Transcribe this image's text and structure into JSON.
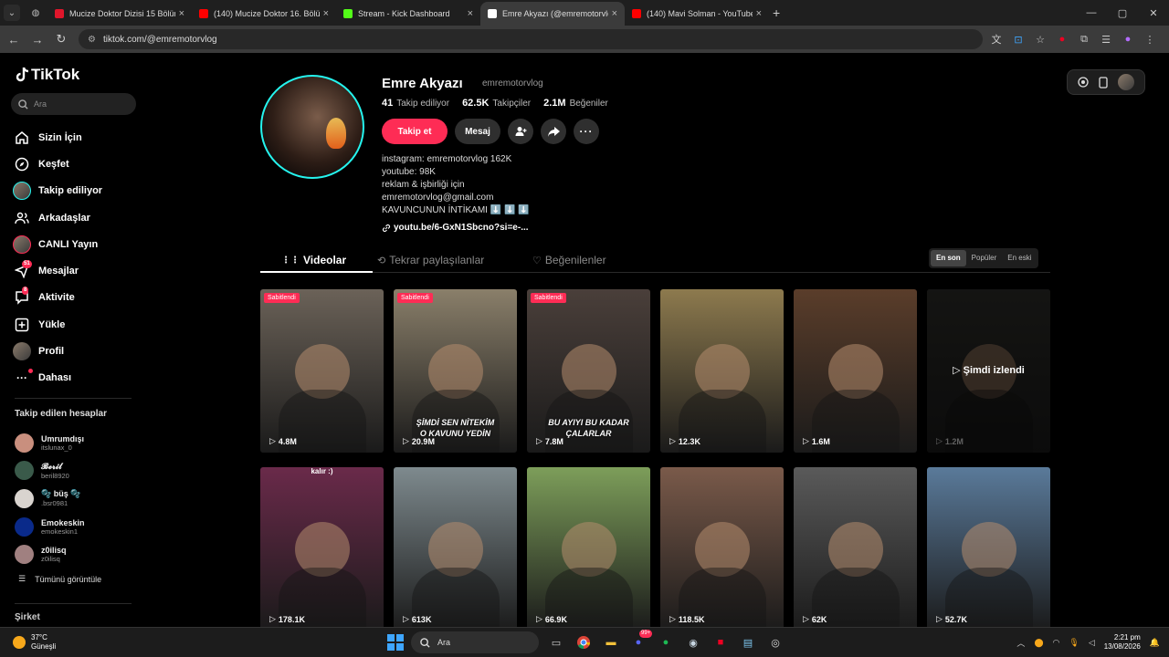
{
  "browser": {
    "tabs": [
      {
        "title": "Mucize Doktor Dizisi 15 Bölüm",
        "color": "#e0162b"
      },
      {
        "title": "(140) Mucize Doktor 16. Bölüm",
        "color": "#ff0000"
      },
      {
        "title": "Stream - Kick Dashboard",
        "color": "#53fc18"
      },
      {
        "title": "Emre Akyazı (@emremotorvlog)",
        "color": "#ffffff",
        "active": true
      },
      {
        "title": "(140) Mavi Solman - YouTube",
        "color": "#ff0000"
      }
    ],
    "url": "tiktok.com/@emremotorvlog"
  },
  "sidebar": {
    "logo": "TikTok",
    "search_placeholder": "Ara",
    "nav": [
      {
        "label": "Sizin İçin",
        "icon": "home-icon"
      },
      {
        "label": "Keşfet",
        "icon": "compass-icon"
      },
      {
        "label": "Takip ediliyor",
        "icon": "following-avatar-icon"
      },
      {
        "label": "Arkadaşlar",
        "icon": "friends-icon"
      },
      {
        "label": "CANLI Yayın",
        "icon": "live-avatar-icon"
      },
      {
        "label": "Mesajlar",
        "icon": "messages-icon",
        "badge": "51"
      },
      {
        "label": "Aktivite",
        "icon": "activity-icon",
        "badge": "8"
      },
      {
        "label": "Yükle",
        "icon": "upload-icon"
      },
      {
        "label": "Profil",
        "icon": "profile-avatar-icon"
      },
      {
        "label": "Dahası",
        "icon": "more-icon"
      }
    ],
    "following_title": "Takip edilen hesaplar",
    "following": [
      {
        "name": "Umrumdışı",
        "user": "itslunax_0"
      },
      {
        "name": "𝓑𝓮𝓻𝓲𝓵",
        "user": "beril8920"
      },
      {
        "name": "🫧 büş 🫧",
        "user": ".bsr0981"
      },
      {
        "name": "Emokeskin",
        "user": "emokeskin1"
      },
      {
        "name": "z0ilisq",
        "user": "z0ilisq"
      }
    ],
    "see_all": "Tümünü görüntüle",
    "company": "Şirket"
  },
  "profile": {
    "name": "Emre Akyazı",
    "username": "emremotorvlog",
    "stats": [
      {
        "value": "41",
        "label": "Takip ediliyor"
      },
      {
        "value": "62.5K",
        "label": "Takipçiler"
      },
      {
        "value": "2.1M",
        "label": "Beğeniler"
      }
    ],
    "follow_label": "Takip et",
    "message_label": "Mesaj",
    "bio": [
      "instagram: emremotorvlog 162K",
      "youtube: 98K",
      "reklam & işbirliği için",
      "emremotorvlog@gmail.com",
      "KAVUNCUNUN İNTİKAMI ⬇️ ⬇️ ⬇️"
    ],
    "link": "youtu.be/6-GxN1Sbcno?si=e-..."
  },
  "content_tabs": {
    "videos": "Videolar",
    "reposts": "Tekrar paylaşılanlar",
    "liked": "Beğenilenler"
  },
  "sort": {
    "latest": "En son",
    "popular": "Popüler",
    "oldest": "En eski"
  },
  "videos": [
    {
      "views": "4.8M",
      "pinned": "Sabitlendi",
      "bg": "#6b6258"
    },
    {
      "views": "20.9M",
      "pinned": "Sabitlendi",
      "caption": "ŞİMDİ SEN NİTEKİM\nO KAVUNU YEDİN",
      "bg": "#8a7f6a"
    },
    {
      "views": "7.8M",
      "pinned": "Sabitlendi",
      "caption": "BU AYIYI BU KADAR\nÇALARLAR",
      "bg": "#4a3f3a"
    },
    {
      "views": "12.3K",
      "bg": "#8d7a4e"
    },
    {
      "views": "1.6M",
      "bg": "#5a3d2a"
    },
    {
      "views": "1.2M",
      "watched": "Şimdi izlendi",
      "bg": "#2e2e2a"
    },
    {
      "views": "178.1K",
      "toptext": "kalır :)",
      "bg": "#6a2a4a"
    },
    {
      "views": "613K",
      "bg": "#7e8a8e"
    },
    {
      "views": "66.9K",
      "bg": "#7d9e5a"
    },
    {
      "views": "118.5K",
      "bg": "#7a5a4a"
    },
    {
      "views": "62K",
      "bg": "#5a5a5a"
    },
    {
      "views": "52.7K",
      "bg": "#5a7a9a"
    }
  ],
  "taskbar": {
    "temp": "37°C",
    "weather": "Güneşli",
    "search": "Ara",
    "time": "2:21 pm",
    "date": "13/08/2026",
    "notif_badge": "99+"
  }
}
